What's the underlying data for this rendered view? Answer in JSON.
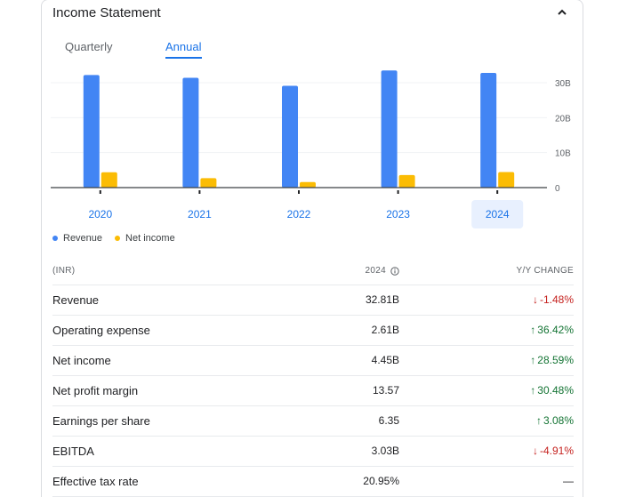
{
  "card": {
    "title": "Income Statement"
  },
  "tabs": [
    {
      "label": "Quarterly",
      "active": false
    },
    {
      "label": "Annual",
      "active": true
    }
  ],
  "colors": {
    "revenue": "#4285f4",
    "net_income": "#fbbc04",
    "accent": "#1a73e8",
    "up": "#137333",
    "down": "#c5221f"
  },
  "chart_data": {
    "type": "bar",
    "categories": [
      "2020",
      "2021",
      "2022",
      "2023",
      "2024"
    ],
    "selected_category": "2024",
    "series": [
      {
        "name": "Revenue",
        "values": [
          32.2,
          31.4,
          29.1,
          33.5,
          32.81
        ]
      },
      {
        "name": "Net income",
        "values": [
          4.4,
          2.7,
          1.6,
          3.6,
          4.45
        ]
      }
    ],
    "y_ticks": [
      {
        "value": 0,
        "label": "0"
      },
      {
        "value": 10,
        "label": "10B"
      },
      {
        "value": 20,
        "label": "20B"
      },
      {
        "value": 30,
        "label": "30B"
      }
    ],
    "ylim": [
      0,
      30
    ],
    "grid": true,
    "legend_position": "bottom-left"
  },
  "legend": {
    "revenue": "Revenue",
    "net_income": "Net income"
  },
  "table": {
    "header": {
      "label": "(INR)",
      "period": "2024",
      "change": "Y/Y CHANGE"
    },
    "rows": [
      {
        "label": "Revenue",
        "value": "32.81B",
        "change": "-1.48%",
        "direction": "down",
        "arrow": "↓"
      },
      {
        "label": "Operating expense",
        "value": "2.61B",
        "change": "36.42%",
        "direction": "up",
        "arrow": "↑"
      },
      {
        "label": "Net income",
        "value": "4.45B",
        "change": "28.59%",
        "direction": "up",
        "arrow": "↑"
      },
      {
        "label": "Net profit margin",
        "value": "13.57",
        "change": "30.48%",
        "direction": "up",
        "arrow": "↑"
      },
      {
        "label": "Earnings per share",
        "value": "6.35",
        "change": "3.08%",
        "direction": "up",
        "arrow": "↑"
      },
      {
        "label": "EBITDA",
        "value": "3.03B",
        "change": "-4.91%",
        "direction": "down",
        "arrow": "↓"
      },
      {
        "label": "Effective tax rate",
        "value": "20.95%",
        "change": "—",
        "direction": "flat",
        "arrow": ""
      }
    ]
  }
}
